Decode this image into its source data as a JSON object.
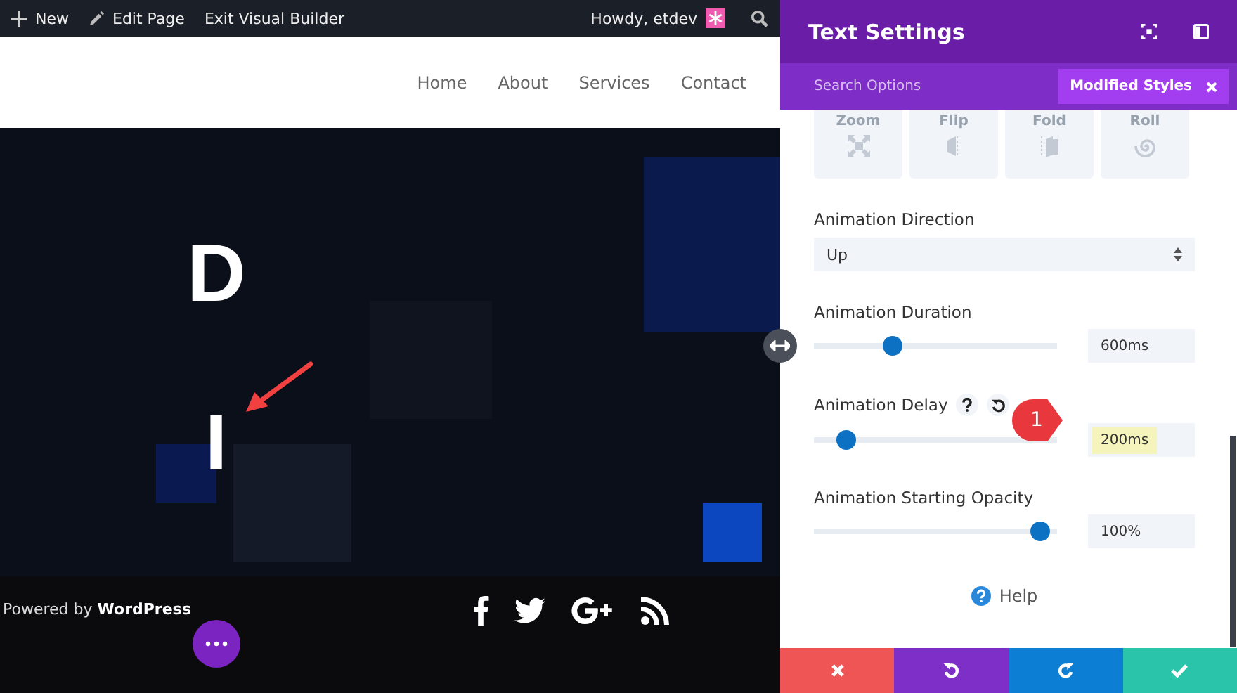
{
  "admin_bar": {
    "items": [
      {
        "kind": "new",
        "label": "New"
      },
      {
        "kind": "edit",
        "label": "Edit Page"
      },
      {
        "kind": "plain",
        "label": "Exit Visual Builder"
      }
    ],
    "greeting": "Howdy, etdev"
  },
  "site_nav": {
    "items": [
      "Home",
      "About",
      "Services",
      "Contact"
    ]
  },
  "hero": {
    "letters": [
      "D",
      "I"
    ]
  },
  "footer": {
    "credit": "Powered by **WordPress**",
    "social": [
      {
        "kind": "facebook"
      },
      {
        "kind": "twitter"
      },
      {
        "kind": "google-plus"
      },
      {
        "kind": "rss"
      }
    ]
  },
  "panel": {
    "title": "Text Settings",
    "search": {
      "placeholder": "Search Options"
    },
    "filter_button": "Modified Styles",
    "animation_styles": [
      {
        "kind": "zoom",
        "label": "Zoom"
      },
      {
        "kind": "flip",
        "label": "Flip"
      },
      {
        "kind": "fold",
        "label": "Fold"
      },
      {
        "kind": "roll",
        "label": "Roll"
      }
    ],
    "direction": {
      "label": "Animation Direction",
      "value": "Up"
    },
    "sliders": [
      {
        "label": "Animation Duration",
        "level": 0.31,
        "reading": "600ms",
        "highlighted": false,
        "tools": false
      },
      {
        "label": "Animation Delay",
        "level": 0.1,
        "reading": "200ms",
        "highlighted": true,
        "tools": true
      },
      {
        "label": "Animation Starting Opacity",
        "level": 0.97,
        "reading": "100%",
        "highlighted": false,
        "tools": false
      }
    ],
    "help": "Help",
    "callout": "1"
  }
}
